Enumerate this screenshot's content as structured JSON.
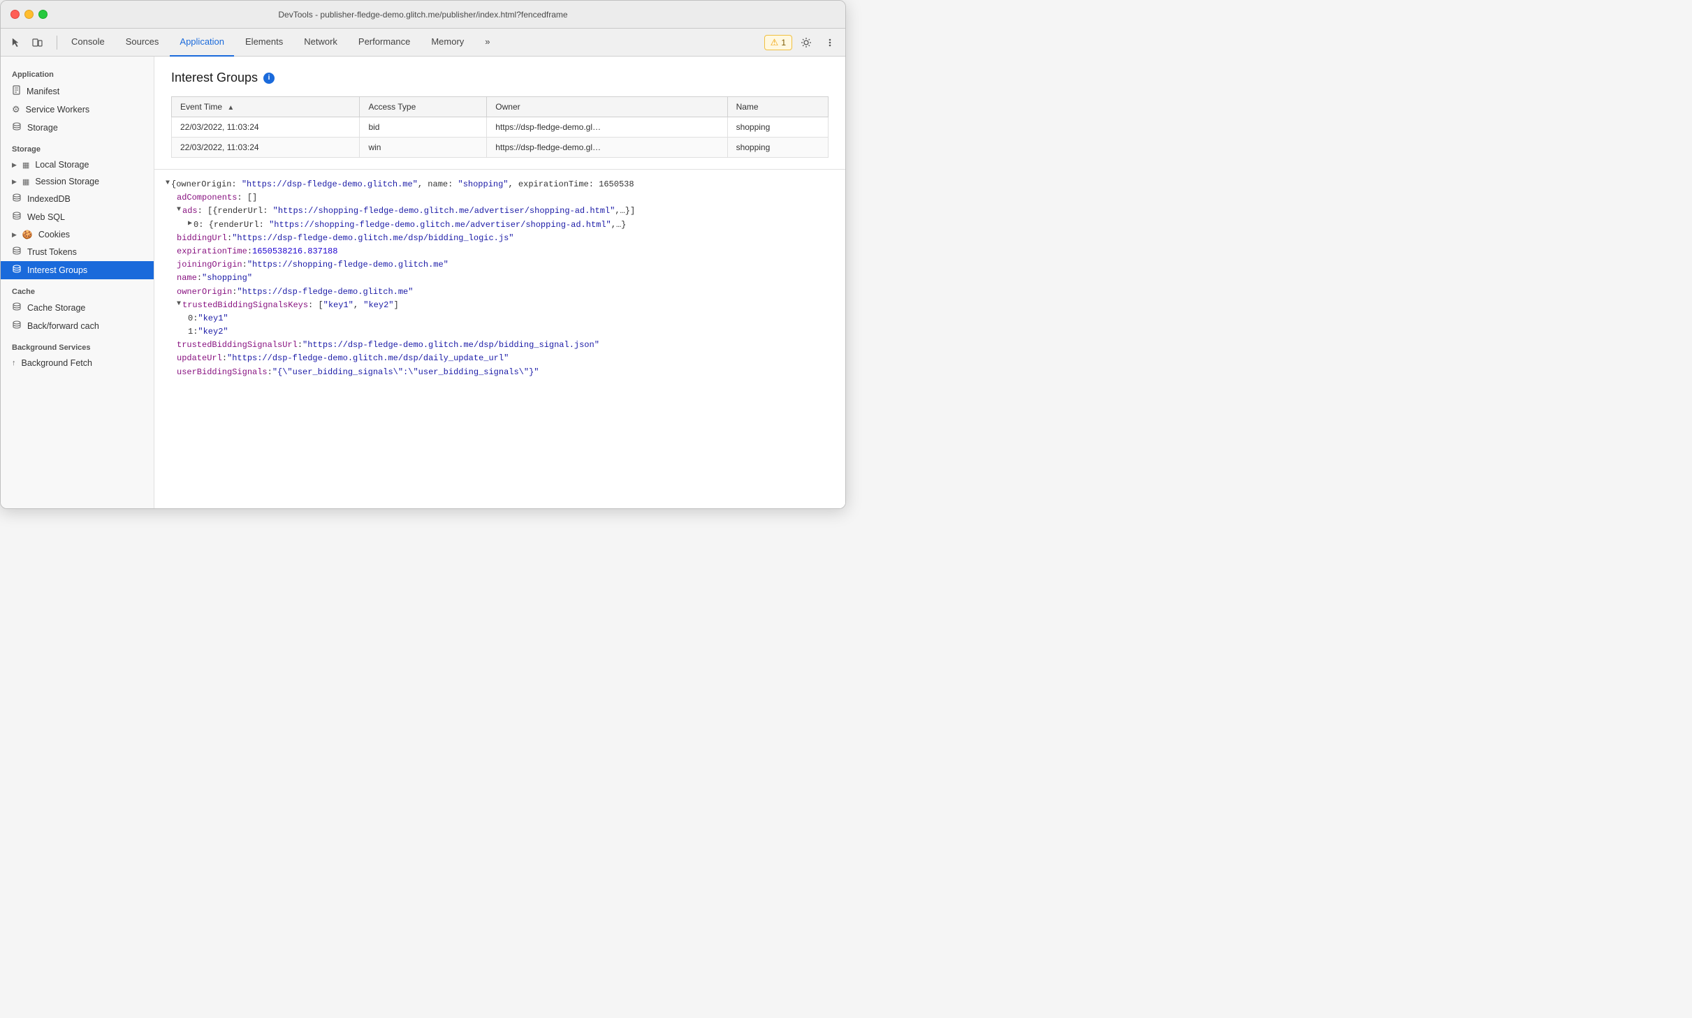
{
  "titlebar": {
    "title": "DevTools - publisher-fledge-demo.glitch.me/publisher/index.html?fencedframe"
  },
  "toolbar": {
    "tabs": [
      "Console",
      "Sources",
      "Application",
      "Elements",
      "Network",
      "Performance",
      "Memory"
    ],
    "active_tab": "Application",
    "more_label": "»",
    "warn_count": "1",
    "warn_label": "⚠ 1"
  },
  "sidebar": {
    "app_section": "Application",
    "app_items": [
      {
        "label": "Manifest",
        "icon": "📄"
      },
      {
        "label": "Service Workers",
        "icon": "⚙"
      },
      {
        "label": "Storage",
        "icon": "🗄"
      }
    ],
    "storage_section": "Storage",
    "storage_items": [
      {
        "label": "Local Storage",
        "icon": "▶",
        "icon2": "▦",
        "has_arrow": true
      },
      {
        "label": "Session Storage",
        "icon": "▶",
        "icon2": "▦",
        "has_arrow": true
      },
      {
        "label": "IndexedDB",
        "icon": "🗄"
      },
      {
        "label": "Web SQL",
        "icon": "🗄"
      },
      {
        "label": "Cookies",
        "icon": "▶",
        "icon2": "🍪",
        "has_arrow": true
      },
      {
        "label": "Trust Tokens",
        "icon": "🗄"
      },
      {
        "label": "Interest Groups",
        "icon": "🗄",
        "active": true
      }
    ],
    "cache_section": "Cache",
    "cache_items": [
      {
        "label": "Cache Storage",
        "icon": "🗄"
      },
      {
        "label": "Back/forward cach",
        "icon": "🗄"
      }
    ],
    "bg_section": "Background Services",
    "bg_items": [
      {
        "label": "Background Fetch",
        "icon": "↑"
      }
    ]
  },
  "interest_groups": {
    "title": "Interest Groups",
    "table": {
      "columns": [
        "Event Time",
        "Access Type",
        "Owner",
        "Name"
      ],
      "rows": [
        {
          "event_time": "22/03/2022, 11:03:24",
          "access_type": "bid",
          "owner": "https://dsp-fledge-demo.gl…",
          "name": "shopping"
        },
        {
          "event_time": "22/03/2022, 11:03:24",
          "access_type": "win",
          "owner": "https://dsp-fledge-demo.gl…",
          "name": "shopping"
        }
      ]
    }
  },
  "detail": {
    "lines": [
      {
        "indent": 0,
        "expand": "▼",
        "content": "{ownerOrigin: \"https://dsp-fledge-demo.glitch.me\", name: \"shopping\", expirationTime: 1650538",
        "type": "plain"
      },
      {
        "indent": 1,
        "expand": "",
        "key": "adComponents",
        "sep": ": ",
        "value": "[]",
        "key_color": "key",
        "val_color": "plain"
      },
      {
        "indent": 1,
        "expand": "▼",
        "key": "ads",
        "sep": ": ",
        "value": "[{renderUrl: \"https://shopping-fledge-demo.glitch.me/advertiser/shopping-ad.html\",…}]",
        "key_color": "key",
        "val_color": "plain"
      },
      {
        "indent": 2,
        "expand": "▶",
        "key": "0",
        "sep": ": ",
        "value": "{renderUrl: \"https://shopping-fledge-demo.glitch.me/advertiser/shopping-ad.html\",…}",
        "key_color": "plain",
        "val_color": "plain"
      },
      {
        "indent": 1,
        "expand": "",
        "key": "biddingUrl",
        "sep": ": ",
        "value": "\"https://dsp-fledge-demo.glitch.me/dsp/bidding_logic.js\"",
        "key_color": "key",
        "val_color": "url"
      },
      {
        "indent": 1,
        "expand": "",
        "key": "expirationTime",
        "sep": ": ",
        "value": "1650538216.837188",
        "key_color": "key",
        "val_color": "number"
      },
      {
        "indent": 1,
        "expand": "",
        "key": "joiningOrigin",
        "sep": ": ",
        "value": "\"https://shopping-fledge-demo.glitch.me\"",
        "key_color": "key",
        "val_color": "url"
      },
      {
        "indent": 1,
        "expand": "",
        "key": "name",
        "sep": ": ",
        "value": "\"shopping\"",
        "key_color": "key",
        "val_color": "url"
      },
      {
        "indent": 1,
        "expand": "",
        "key": "ownerOrigin",
        "sep": ": ",
        "value": "\"https://dsp-fledge-demo.glitch.me\"",
        "key_color": "key",
        "val_color": "url"
      },
      {
        "indent": 1,
        "expand": "▼",
        "key": "trustedBiddingSignalsKeys",
        "sep": ": ",
        "value": "[\"key1\", \"key2\"]",
        "key_color": "key",
        "val_color": "plain"
      },
      {
        "indent": 2,
        "expand": "",
        "key": "0",
        "sep": ": ",
        "value": "\"key1\"",
        "key_color": "plain",
        "val_color": "url"
      },
      {
        "indent": 2,
        "expand": "",
        "key": "1",
        "sep": ": ",
        "value": "\"key2\"",
        "key_color": "plain",
        "val_color": "url"
      },
      {
        "indent": 1,
        "expand": "",
        "key": "trustedBiddingSignalsUrl",
        "sep": ": ",
        "value": "\"https://dsp-fledge-demo.glitch.me/dsp/bidding_signal.json\"",
        "key_color": "key",
        "val_color": "url"
      },
      {
        "indent": 1,
        "expand": "",
        "key": "updateUrl",
        "sep": ": ",
        "value": "\"https://dsp-fledge-demo.glitch.me/dsp/daily_update_url\"",
        "key_color": "key",
        "val_color": "url"
      },
      {
        "indent": 1,
        "expand": "",
        "key": "userBiddingSignals",
        "sep": ": ",
        "value": "\"{\\\"user_bidding_signals\\\":\\\"user_bidding_signals\\\"}\"",
        "key_color": "key",
        "val_color": "url"
      }
    ]
  }
}
